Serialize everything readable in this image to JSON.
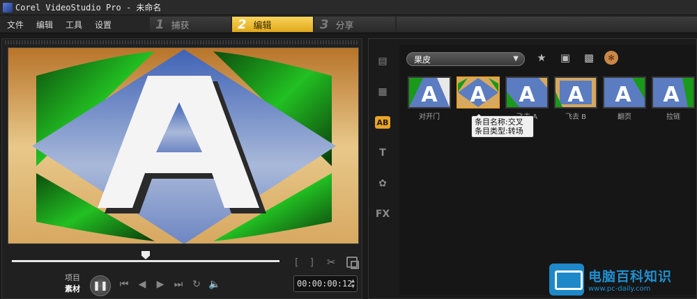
{
  "window": {
    "title": "Corel VideoStudio Pro - 未命名"
  },
  "menu": [
    "文件",
    "编辑",
    "工具",
    "设置"
  ],
  "steps": [
    {
      "num": "1",
      "label": "捕获",
      "active": false
    },
    {
      "num": "2",
      "label": "编辑",
      "active": true
    },
    {
      "num": "3",
      "label": "分享",
      "active": false
    }
  ],
  "player": {
    "mode_project": "项目",
    "mode_clip": "素材",
    "scrub_position": 0.5,
    "timecode": "00:00:00:12",
    "trim_in": "[",
    "trim_out": "]"
  },
  "library": {
    "category": "果皮",
    "side_tabs": [
      "media-icon",
      "instant-project-icon",
      "transition-icon",
      "title-icon",
      "graphic-icon",
      "filter-icon"
    ],
    "fx_label": "FX",
    "title_label": "T",
    "transition_label": "AB",
    "thumbnails": [
      {
        "caption": "对开门",
        "selected": false
      },
      {
        "caption": "",
        "selected": true
      },
      {
        "caption": "飞去 A",
        "selected": false
      },
      {
        "caption": "飞去 B",
        "selected": false
      },
      {
        "caption": "翻页",
        "selected": false
      },
      {
        "caption": "拉链",
        "selected": false
      }
    ],
    "tooltip_line1": "条目名称:交叉",
    "tooltip_line2": "条目类型:转场"
  },
  "watermark": {
    "main": "电脑百科知识",
    "url": "www.pc-daily.com"
  },
  "colors": {
    "accent": "#e8a42a",
    "brand": "#1e90d0"
  }
}
